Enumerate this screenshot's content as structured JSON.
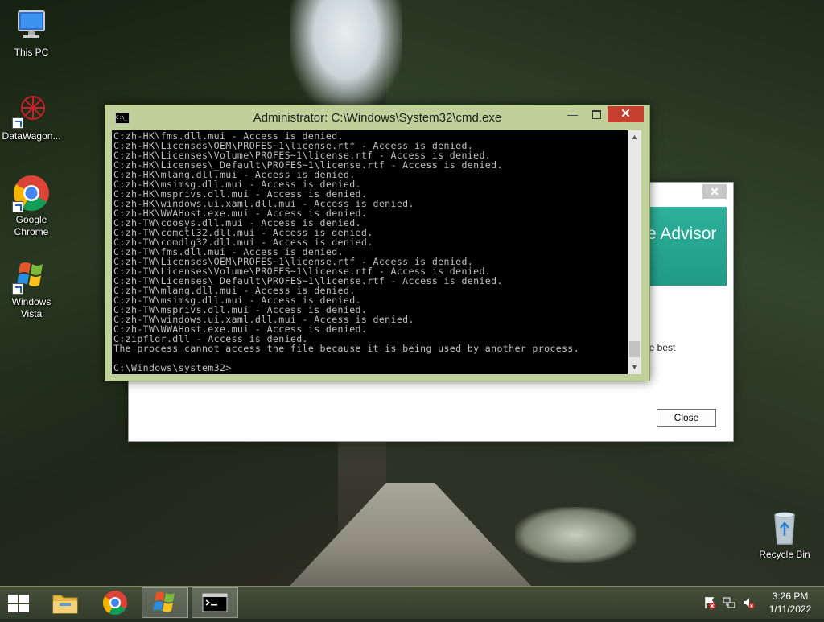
{
  "desktop": {
    "icons": [
      {
        "label": "This PC",
        "icon": "computer-icon"
      },
      {
        "label": "DataWagon...",
        "icon": "datawagon-icon"
      },
      {
        "label": "Google\nChrome",
        "icon": "chrome-icon"
      },
      {
        "label": "Windows\nVista",
        "icon": "windows-vista-icon"
      },
      {
        "label": "Recycle Bin",
        "icon": "recycle-bin-icon"
      }
    ]
  },
  "background_dialog": {
    "banner_text": "e Advisor",
    "fragment_text": "he best",
    "close_button": "Close",
    "title_close": "✕"
  },
  "cmd_window": {
    "title": "Administrator: C:\\Windows\\System32\\cmd.exe",
    "icon_text": "C:\\_",
    "lines": [
      "C:zh-HK\\fms.dll.mui - Access is denied.",
      "C:zh-HK\\Licenses\\OEM\\PROFES~1\\license.rtf - Access is denied.",
      "C:zh-HK\\Licenses\\Volume\\PROFES~1\\license.rtf - Access is denied.",
      "C:zh-HK\\Licenses\\_Default\\PROFES~1\\license.rtf - Access is denied.",
      "C:zh-HK\\mlang.dll.mui - Access is denied.",
      "C:zh-HK\\msimsg.dll.mui - Access is denied.",
      "C:zh-HK\\msprivs.dll.mui - Access is denied.",
      "C:zh-HK\\windows.ui.xaml.dll.mui - Access is denied.",
      "C:zh-HK\\WWAHost.exe.mui - Access is denied.",
      "C:zh-TW\\cdosys.dll.mui - Access is denied.",
      "C:zh-TW\\comctl32.dll.mui - Access is denied.",
      "C:zh-TW\\comdlg32.dll.mui - Access is denied.",
      "C:zh-TW\\fms.dll.mui - Access is denied.",
      "C:zh-TW\\Licenses\\OEM\\PROFES~1\\license.rtf - Access is denied.",
      "C:zh-TW\\Licenses\\Volume\\PROFES~1\\license.rtf - Access is denied.",
      "C:zh-TW\\Licenses\\_Default\\PROFES~1\\license.rtf - Access is denied.",
      "C:zh-TW\\mlang.dll.mui - Access is denied.",
      "C:zh-TW\\msimsg.dll.mui - Access is denied.",
      "C:zh-TW\\msprivs.dll.mui - Access is denied.",
      "C:zh-TW\\windows.ui.xaml.dll.mui - Access is denied.",
      "C:zh-TW\\WWAHost.exe.mui - Access is denied.",
      "C:zipfldr.dll - Access is denied.",
      "The process cannot access the file because it is being used by another process.",
      "",
      "C:\\Windows\\system32>"
    ],
    "minimize": "—",
    "close": "✕"
  },
  "taskbar": {
    "items": [
      {
        "name": "start-button",
        "icon": "windows-logo-icon"
      },
      {
        "name": "file-explorer",
        "icon": "folder-icon"
      },
      {
        "name": "chrome",
        "icon": "chrome-icon"
      },
      {
        "name": "windows-vista",
        "icon": "windows-vista-icon"
      },
      {
        "name": "cmd",
        "icon": "cmd-icon"
      }
    ],
    "tray": {
      "icons": [
        "action-center-flag-icon",
        "network-icon",
        "volume-muted-icon"
      ],
      "time": "3:26 PM",
      "date": "1/11/2022"
    }
  }
}
